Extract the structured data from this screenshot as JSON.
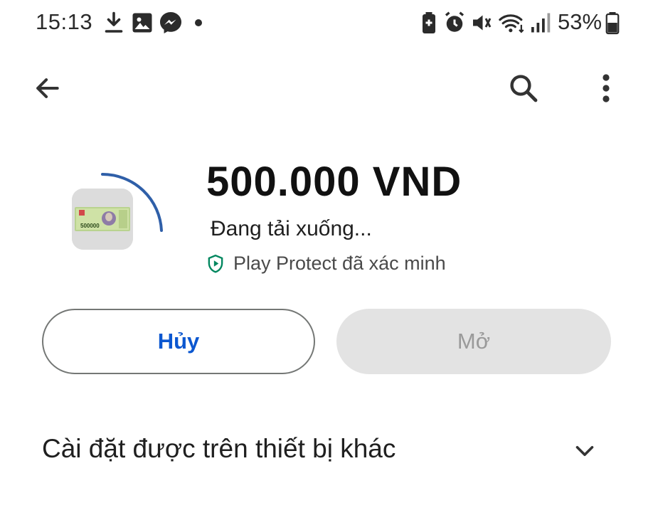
{
  "status_bar": {
    "time": "15:13",
    "battery": "53%",
    "left_icons": [
      "download-icon",
      "image-icon",
      "messenger-icon",
      "dot-icon"
    ],
    "right_icons": [
      "battery-saver-icon",
      "alarm-icon",
      "mute-icon",
      "wifi-icon",
      "signal-icon",
      "battery-icon"
    ]
  },
  "app_bar": {
    "back_icon": "arrow-back-icon",
    "search_icon": "search-icon",
    "more_icon": "more-vert-icon"
  },
  "app": {
    "title": "500.000 VND",
    "download_status": "Đang tải xuống...",
    "play_protect": "Play Protect đã xác minh",
    "icon_note_text": "500000"
  },
  "buttons": {
    "cancel": "Hủy",
    "open": "Mở"
  },
  "sections": {
    "other_devices": "Cài đặt được trên thiết bị khác"
  },
  "colors": {
    "accent_blue": "#0b57d0",
    "progress_arc": "#2f5fa8",
    "play_protect_green": "#01875f",
    "disabled_bg": "#e3e3e3",
    "disabled_text": "#9a9a9a"
  }
}
